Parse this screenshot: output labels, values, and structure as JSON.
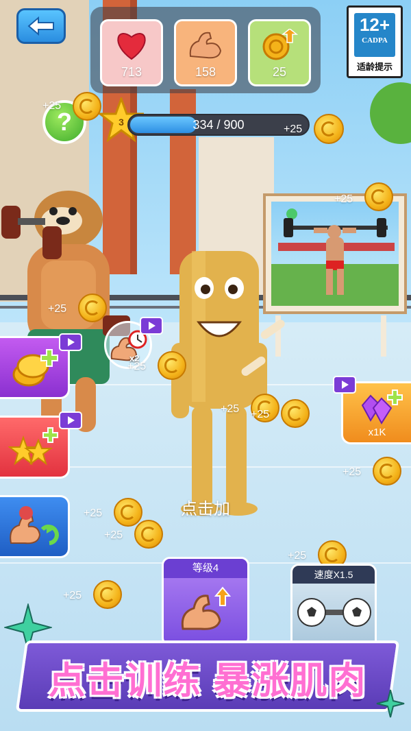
{
  "stats": [
    {
      "name": "health",
      "icon": "heart-icon",
      "value": "713",
      "color": "#f7c8c8"
    },
    {
      "name": "strength",
      "icon": "muscle-icon",
      "value": "158",
      "color": "#f8b47c"
    },
    {
      "name": "coin-income",
      "icon": "coin-upgrade-icon",
      "value": "25",
      "color": "#b6e07a"
    }
  ],
  "age_rating": {
    "age": "12+",
    "org": "CADPA",
    "caption": "适龄提示"
  },
  "level": {
    "number": "3",
    "xp_text": "334 / 900",
    "progress": 0.371
  },
  "floating_rewards": [
    "+25",
    "+25",
    "+25",
    "+25",
    "+25",
    "+25",
    "+25",
    "+25",
    "+25",
    "+25",
    "+25",
    "+25"
  ],
  "gem_reward": {
    "label": "x1K"
  },
  "boost": {
    "multiplier": "x2"
  },
  "tap_hint": "点击加",
  "upgrade_cards": {
    "level_card": {
      "label": "等级4"
    },
    "speed_card": {
      "label": "速度X1.5"
    }
  },
  "slogan": "点击训练 暴涨肌肉",
  "colors": {
    "accent_purple": "#7a4ee0",
    "accent_orange": "#f08c1d",
    "coin": "#f4b31a"
  }
}
